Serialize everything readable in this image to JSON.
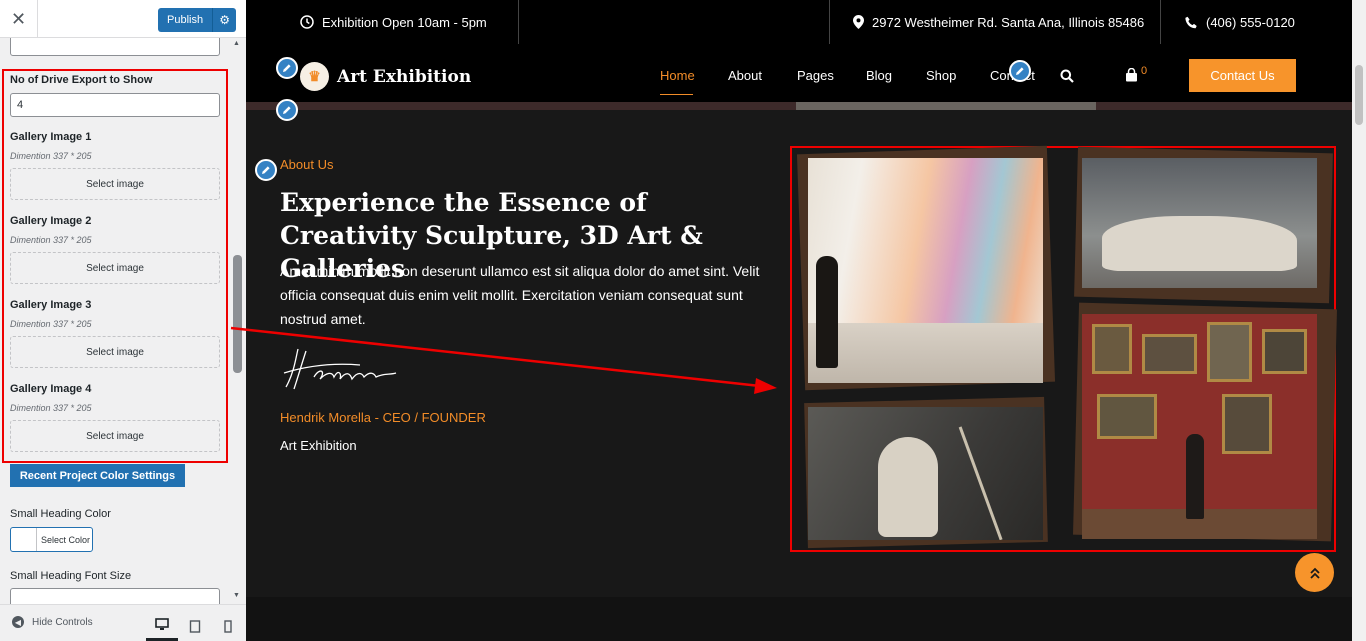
{
  "customizer": {
    "close_icon": "close-icon",
    "publish_label": "Publish",
    "gear_icon": "gear-icon",
    "fields": [
      {
        "label": "No of Drive Export to Show",
        "value": "4"
      }
    ],
    "gallery": [
      {
        "label": "Gallery Image 1",
        "desc": "Dimention 337 * 205",
        "button": "Select image"
      },
      {
        "label": "Gallery Image 2",
        "desc": "Dimention 337 * 205",
        "button": "Select image"
      },
      {
        "label": "Gallery Image 3",
        "desc": "Dimention 337 * 205",
        "button": "Select image"
      },
      {
        "label": "Gallery Image 4",
        "desc": "Dimention 337 * 205",
        "button": "Select image"
      }
    ],
    "section_button": "Recent Project Color Settings",
    "small_heading_color_label": "Small Heading Color",
    "select_color_label": "Select Color",
    "small_heading_font_size_label": "Small Heading Font Size",
    "hide_controls": "Hide Controls"
  },
  "site": {
    "topbar": {
      "hours": "Exhibition Open 10am - 5pm",
      "address": "2972 Westheimer Rd. Santa Ana, Illinois 85486",
      "phone": "(406) 555-0120"
    },
    "logo_text": "Art Exhibition",
    "menu": [
      "Home",
      "About",
      "Pages",
      "Blog",
      "Shop",
      "Contact"
    ],
    "cart_count": "0",
    "contact_button": "Contact Us",
    "about": {
      "small_heading": "About Us",
      "title": "Experience the Essence of Creativity Sculpture, 3D Art & Galleries",
      "paragraph": "Amet minim mollit non deserunt ullamco est sit aliqua dolor do amet sint. Velit officia consequat duis enim velit mollit. Exercitation veniam consequat sunt nostrud amet.",
      "signature_text": "Hendrik",
      "ceo": "Hendrik Morella - CEO / FOUNDER",
      "org": "Art Exhibition"
    }
  },
  "colors": {
    "accent": "#f7942b",
    "wp_blue": "#2271b1",
    "highlight": "#e00000"
  }
}
